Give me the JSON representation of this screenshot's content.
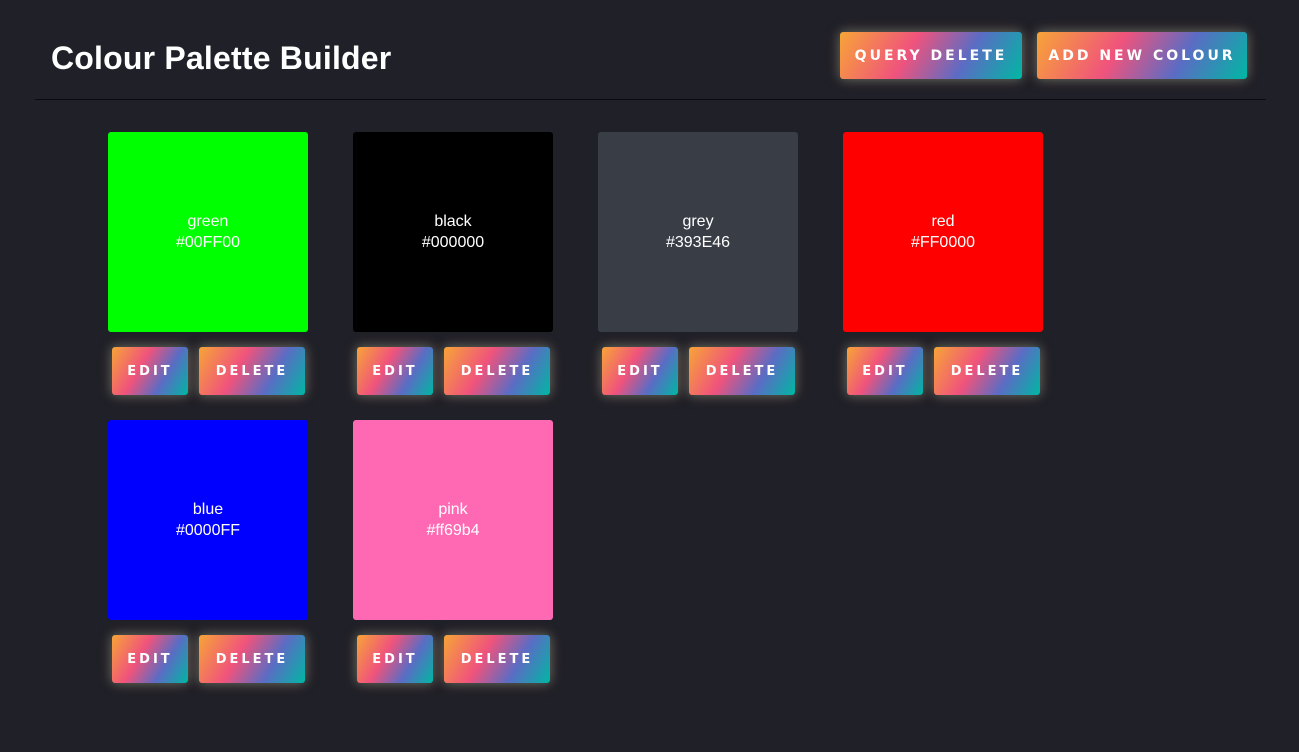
{
  "header": {
    "title": "Colour Palette Builder",
    "query_delete_label": "QUERY DELETE",
    "add_new_label": "ADD NEW COLOUR"
  },
  "colours": [
    {
      "name": "green",
      "hex": "#00FF00",
      "swatch": "#00ff00",
      "edit_label": "EDIT",
      "delete_label": "DELETE"
    },
    {
      "name": "black",
      "hex": "#000000",
      "swatch": "#000000",
      "edit_label": "EDIT",
      "delete_label": "DELETE"
    },
    {
      "name": "grey",
      "hex": "#393E46",
      "swatch": "#393e46",
      "edit_label": "EDIT",
      "delete_label": "DELETE"
    },
    {
      "name": "red",
      "hex": "#FF0000",
      "swatch": "#ff0000",
      "edit_label": "EDIT",
      "delete_label": "DELETE"
    },
    {
      "name": "blue",
      "hex": "#0000FF",
      "swatch": "#0000ff",
      "edit_label": "EDIT",
      "delete_label": "DELETE"
    },
    {
      "name": "pink",
      "hex": "#ff69b4",
      "swatch": "#ff69b4",
      "edit_label": "EDIT",
      "delete_label": "DELETE"
    }
  ],
  "theme": {
    "background": "#1f2028",
    "button_gradient": [
      "#f7a437",
      "#f0537c",
      "#5b6cc4",
      "#00b7a3"
    ]
  }
}
